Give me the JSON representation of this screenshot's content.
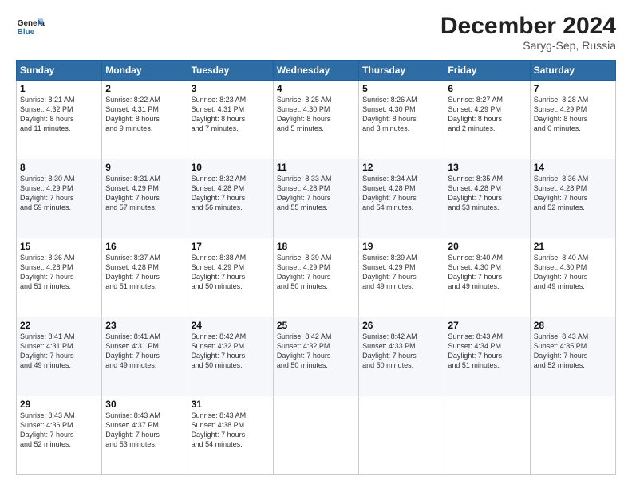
{
  "logo": {
    "line1": "General",
    "line2": "Blue"
  },
  "title": "December 2024",
  "subtitle": "Saryg-Sep, Russia",
  "days_header": [
    "Sunday",
    "Monday",
    "Tuesday",
    "Wednesday",
    "Thursday",
    "Friday",
    "Saturday"
  ],
  "weeks": [
    [
      {
        "day": "1",
        "lines": [
          "Sunrise: 8:21 AM",
          "Sunset: 4:32 PM",
          "Daylight: 8 hours",
          "and 11 minutes."
        ]
      },
      {
        "day": "2",
        "lines": [
          "Sunrise: 8:22 AM",
          "Sunset: 4:31 PM",
          "Daylight: 8 hours",
          "and 9 minutes."
        ]
      },
      {
        "day": "3",
        "lines": [
          "Sunrise: 8:23 AM",
          "Sunset: 4:31 PM",
          "Daylight: 8 hours",
          "and 7 minutes."
        ]
      },
      {
        "day": "4",
        "lines": [
          "Sunrise: 8:25 AM",
          "Sunset: 4:30 PM",
          "Daylight: 8 hours",
          "and 5 minutes."
        ]
      },
      {
        "day": "5",
        "lines": [
          "Sunrise: 8:26 AM",
          "Sunset: 4:30 PM",
          "Daylight: 8 hours",
          "and 3 minutes."
        ]
      },
      {
        "day": "6",
        "lines": [
          "Sunrise: 8:27 AM",
          "Sunset: 4:29 PM",
          "Daylight: 8 hours",
          "and 2 minutes."
        ]
      },
      {
        "day": "7",
        "lines": [
          "Sunrise: 8:28 AM",
          "Sunset: 4:29 PM",
          "Daylight: 8 hours",
          "and 0 minutes."
        ]
      }
    ],
    [
      {
        "day": "8",
        "lines": [
          "Sunrise: 8:30 AM",
          "Sunset: 4:29 PM",
          "Daylight: 7 hours",
          "and 59 minutes."
        ]
      },
      {
        "day": "9",
        "lines": [
          "Sunrise: 8:31 AM",
          "Sunset: 4:29 PM",
          "Daylight: 7 hours",
          "and 57 minutes."
        ]
      },
      {
        "day": "10",
        "lines": [
          "Sunrise: 8:32 AM",
          "Sunset: 4:28 PM",
          "Daylight: 7 hours",
          "and 56 minutes."
        ]
      },
      {
        "day": "11",
        "lines": [
          "Sunrise: 8:33 AM",
          "Sunset: 4:28 PM",
          "Daylight: 7 hours",
          "and 55 minutes."
        ]
      },
      {
        "day": "12",
        "lines": [
          "Sunrise: 8:34 AM",
          "Sunset: 4:28 PM",
          "Daylight: 7 hours",
          "and 54 minutes."
        ]
      },
      {
        "day": "13",
        "lines": [
          "Sunrise: 8:35 AM",
          "Sunset: 4:28 PM",
          "Daylight: 7 hours",
          "and 53 minutes."
        ]
      },
      {
        "day": "14",
        "lines": [
          "Sunrise: 8:36 AM",
          "Sunset: 4:28 PM",
          "Daylight: 7 hours",
          "and 52 minutes."
        ]
      }
    ],
    [
      {
        "day": "15",
        "lines": [
          "Sunrise: 8:36 AM",
          "Sunset: 4:28 PM",
          "Daylight: 7 hours",
          "and 51 minutes."
        ]
      },
      {
        "day": "16",
        "lines": [
          "Sunrise: 8:37 AM",
          "Sunset: 4:28 PM",
          "Daylight: 7 hours",
          "and 51 minutes."
        ]
      },
      {
        "day": "17",
        "lines": [
          "Sunrise: 8:38 AM",
          "Sunset: 4:29 PM",
          "Daylight: 7 hours",
          "and 50 minutes."
        ]
      },
      {
        "day": "18",
        "lines": [
          "Sunrise: 8:39 AM",
          "Sunset: 4:29 PM",
          "Daylight: 7 hours",
          "and 50 minutes."
        ]
      },
      {
        "day": "19",
        "lines": [
          "Sunrise: 8:39 AM",
          "Sunset: 4:29 PM",
          "Daylight: 7 hours",
          "and 49 minutes."
        ]
      },
      {
        "day": "20",
        "lines": [
          "Sunrise: 8:40 AM",
          "Sunset: 4:30 PM",
          "Daylight: 7 hours",
          "and 49 minutes."
        ]
      },
      {
        "day": "21",
        "lines": [
          "Sunrise: 8:40 AM",
          "Sunset: 4:30 PM",
          "Daylight: 7 hours",
          "and 49 minutes."
        ]
      }
    ],
    [
      {
        "day": "22",
        "lines": [
          "Sunrise: 8:41 AM",
          "Sunset: 4:31 PM",
          "Daylight: 7 hours",
          "and 49 minutes."
        ]
      },
      {
        "day": "23",
        "lines": [
          "Sunrise: 8:41 AM",
          "Sunset: 4:31 PM",
          "Daylight: 7 hours",
          "and 49 minutes."
        ]
      },
      {
        "day": "24",
        "lines": [
          "Sunrise: 8:42 AM",
          "Sunset: 4:32 PM",
          "Daylight: 7 hours",
          "and 50 minutes."
        ]
      },
      {
        "day": "25",
        "lines": [
          "Sunrise: 8:42 AM",
          "Sunset: 4:32 PM",
          "Daylight: 7 hours",
          "and 50 minutes."
        ]
      },
      {
        "day": "26",
        "lines": [
          "Sunrise: 8:42 AM",
          "Sunset: 4:33 PM",
          "Daylight: 7 hours",
          "and 50 minutes."
        ]
      },
      {
        "day": "27",
        "lines": [
          "Sunrise: 8:43 AM",
          "Sunset: 4:34 PM",
          "Daylight: 7 hours",
          "and 51 minutes."
        ]
      },
      {
        "day": "28",
        "lines": [
          "Sunrise: 8:43 AM",
          "Sunset: 4:35 PM",
          "Daylight: 7 hours",
          "and 52 minutes."
        ]
      }
    ],
    [
      {
        "day": "29",
        "lines": [
          "Sunrise: 8:43 AM",
          "Sunset: 4:36 PM",
          "Daylight: 7 hours",
          "and 52 minutes."
        ]
      },
      {
        "day": "30",
        "lines": [
          "Sunrise: 8:43 AM",
          "Sunset: 4:37 PM",
          "Daylight: 7 hours",
          "and 53 minutes."
        ]
      },
      {
        "day": "31",
        "lines": [
          "Sunrise: 8:43 AM",
          "Sunset: 4:38 PM",
          "Daylight: 7 hours",
          "and 54 minutes."
        ]
      },
      null,
      null,
      null,
      null
    ]
  ]
}
